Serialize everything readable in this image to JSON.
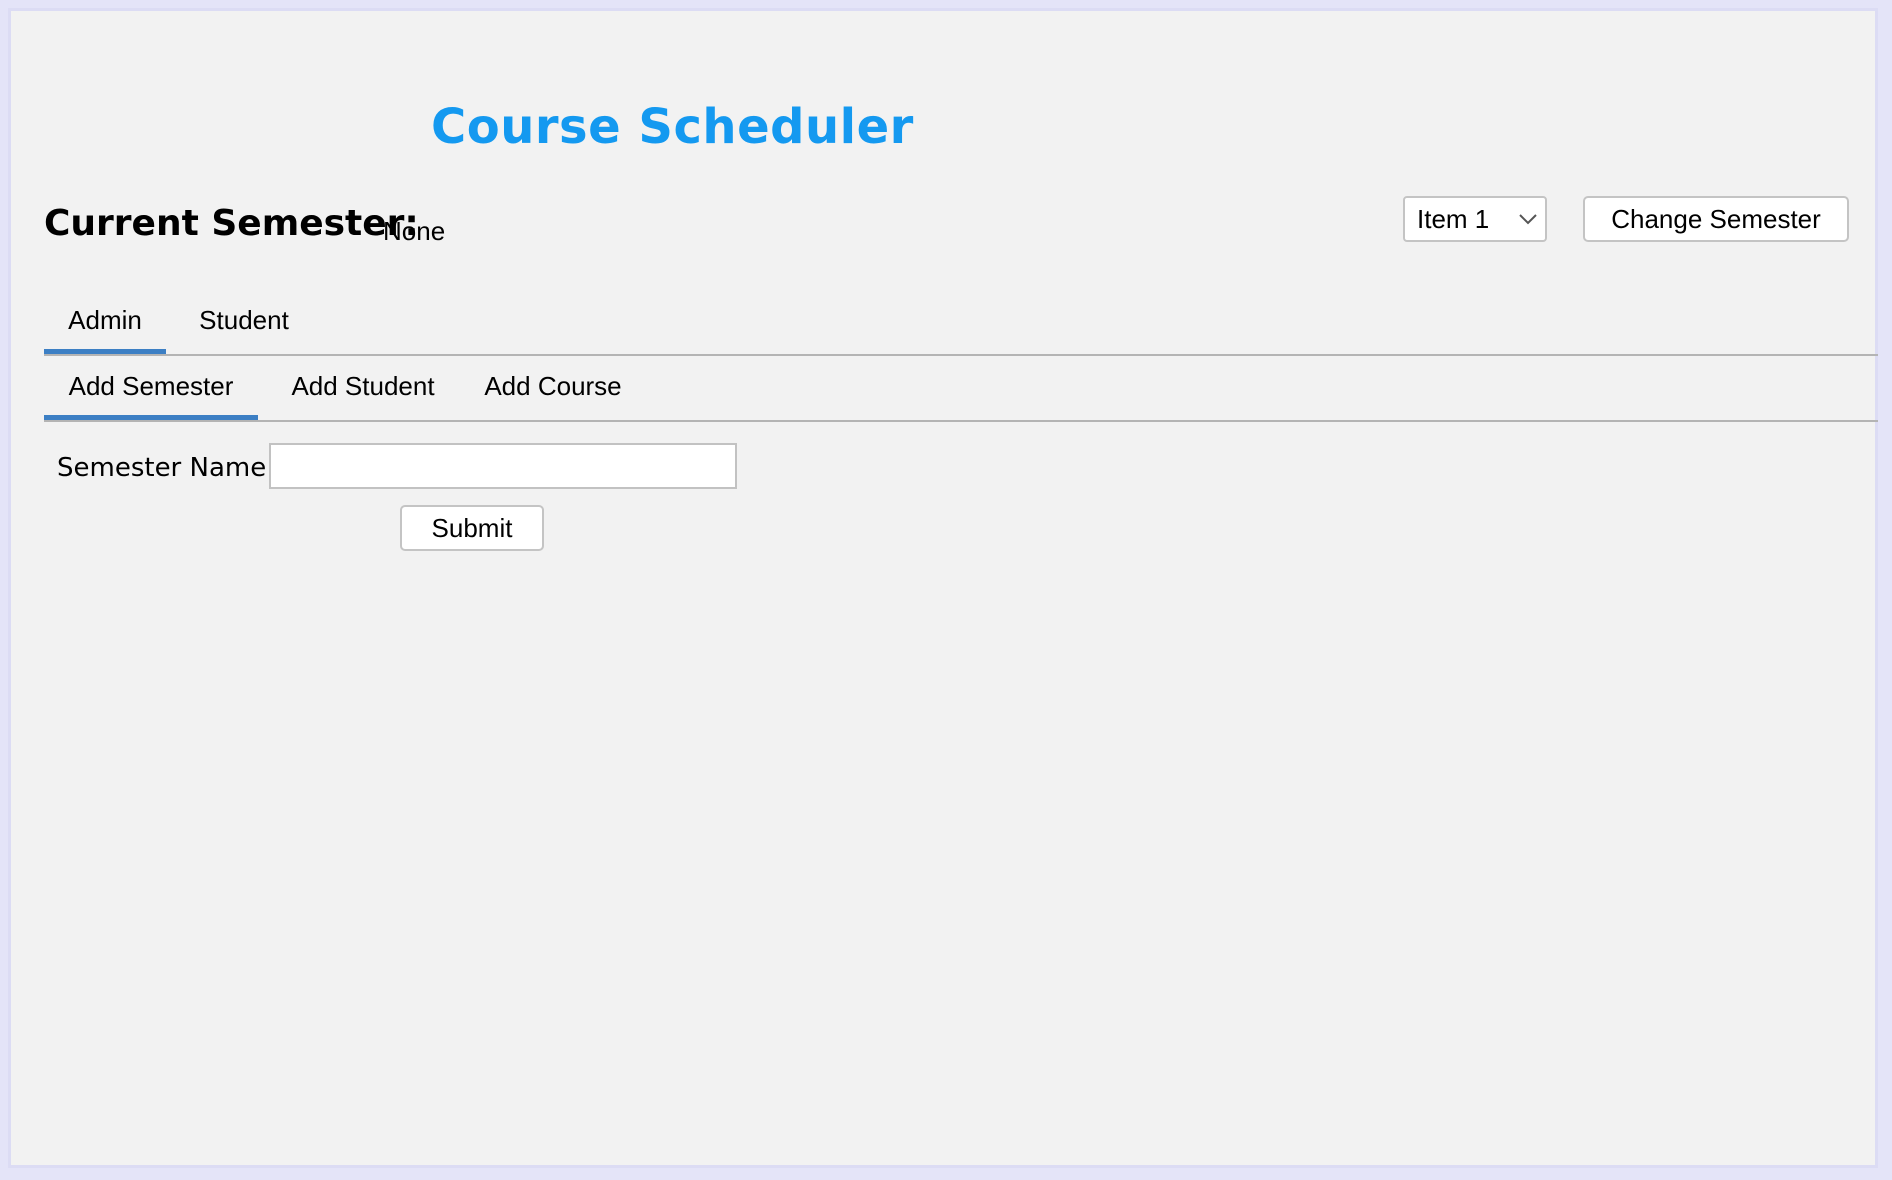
{
  "app": {
    "title": "Course Scheduler",
    "title_color": "#1499f0"
  },
  "header": {
    "current_semester_label": "Current Semester:",
    "current_semester_value": "None",
    "semester_select": {
      "selected": "Item 1",
      "icon": "chevron-down-icon"
    },
    "change_semester_label": "Change Semester"
  },
  "main_tabs": [
    {
      "label": "Admin",
      "selected": true
    },
    {
      "label": "Student",
      "selected": false
    }
  ],
  "admin_tabs": [
    {
      "label": "Add Semester",
      "selected": true
    },
    {
      "label": "Add Student",
      "selected": false
    },
    {
      "label": "Add Course",
      "selected": false
    }
  ],
  "form": {
    "semester_name_label": "Semester Name:",
    "semester_name_value": "",
    "submit_label": "Submit"
  },
  "colors": {
    "tab_indicator": "#3c7fc4",
    "background": "#f2f2f2"
  }
}
